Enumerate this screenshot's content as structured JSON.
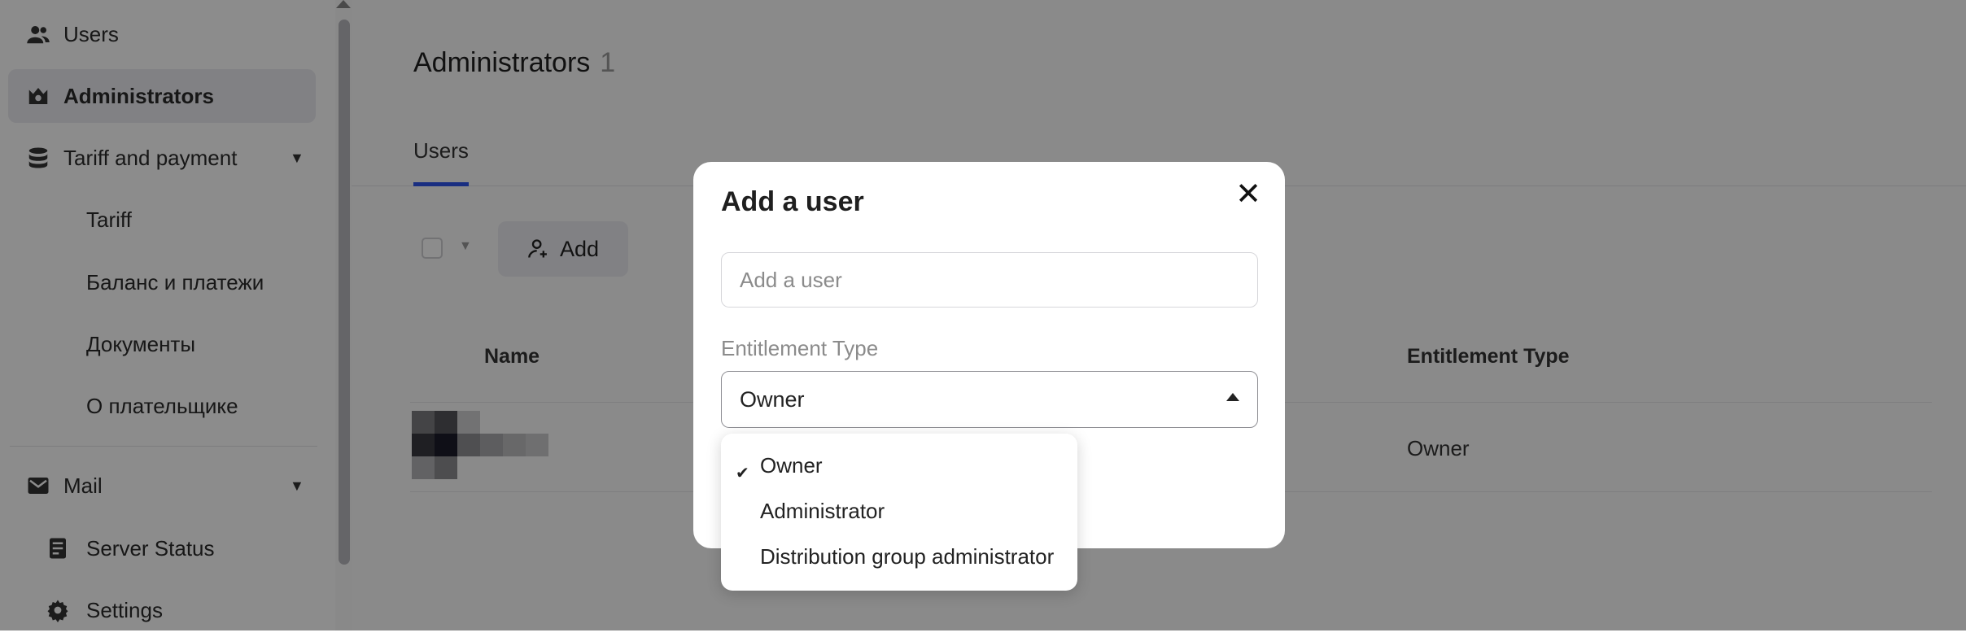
{
  "sidebar": {
    "items": [
      {
        "label": "Users",
        "icon": "users-icon"
      },
      {
        "label": "Administrators",
        "icon": "crown-icon"
      },
      {
        "label": "Tariff and payment",
        "icon": "database-icon"
      },
      {
        "label": "Tariff"
      },
      {
        "label": "Баланс и платежи"
      },
      {
        "label": "Документы"
      },
      {
        "label": "О плательщике"
      },
      {
        "label": "Mail",
        "icon": "mail-icon"
      },
      {
        "label": "Server Status",
        "icon": "server-icon"
      },
      {
        "label": "Settings",
        "icon": "gear-icon"
      }
    ]
  },
  "main": {
    "title": "Administrators",
    "count": "1",
    "tab": "Users",
    "add_label": "Add",
    "columns": {
      "name": "Name",
      "entitlement": "Entitlement Type"
    },
    "row": {
      "entitlement": "Owner"
    }
  },
  "modal": {
    "title": "Add a user",
    "input_placeholder": "Add a user",
    "field_label": "Entitlement Type",
    "selected": "Owner",
    "options": [
      "Owner",
      "Administrator",
      "Distribution group administrator"
    ]
  },
  "colors": {
    "accent": "#2f54eb",
    "overlay": "rgba(0,0,0,0.45)"
  }
}
